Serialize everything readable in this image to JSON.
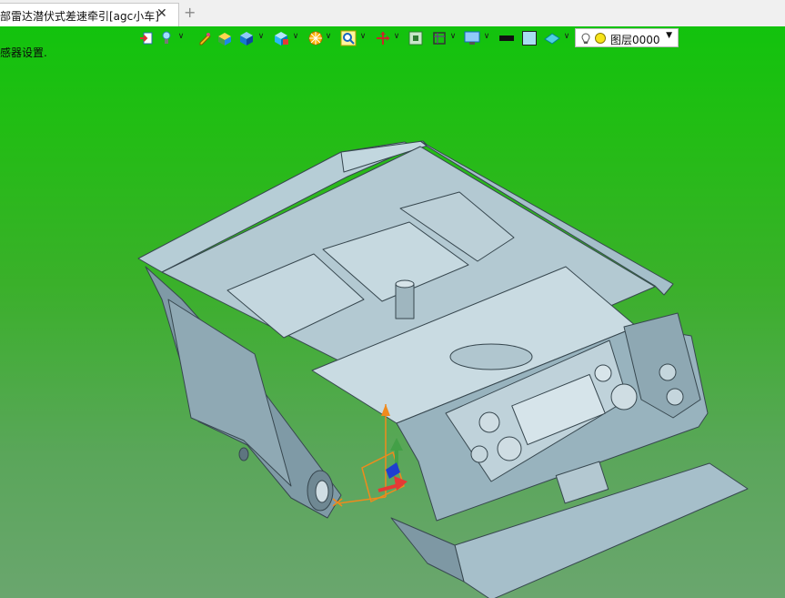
{
  "tabs": [
    {
      "label": "部雷达潜伏式差速牵引[agc小车]",
      "close_glyph": "✕"
    }
  ],
  "new_tab_glyph": "+",
  "status_hint": "感器设置.",
  "toolbar": {
    "icons": [
      "import-icon",
      "light-icon",
      "pen-icon",
      "box-color-icon",
      "cube-solid-icon",
      "cube-view-icon",
      "render-wheel-icon",
      "zoom-icon",
      "axis-move-icon",
      "fit-view-icon",
      "frame-icon",
      "display-icon",
      "color-black-icon",
      "color-fill-icon",
      "plane-icon"
    ],
    "layer_dropdown": {
      "value": "图层0000",
      "arrow": "▼"
    }
  },
  "colors": {
    "viewport_top": "#12c30d",
    "viewport_bottom": "#6aa66e",
    "model_body": "#a9c4cf",
    "model_edge": "#37474f",
    "axis_x": "#e53935",
    "axis_y": "#43a047",
    "axis_z": "#1e3fd0",
    "axis_handle": "#f08a1c"
  }
}
